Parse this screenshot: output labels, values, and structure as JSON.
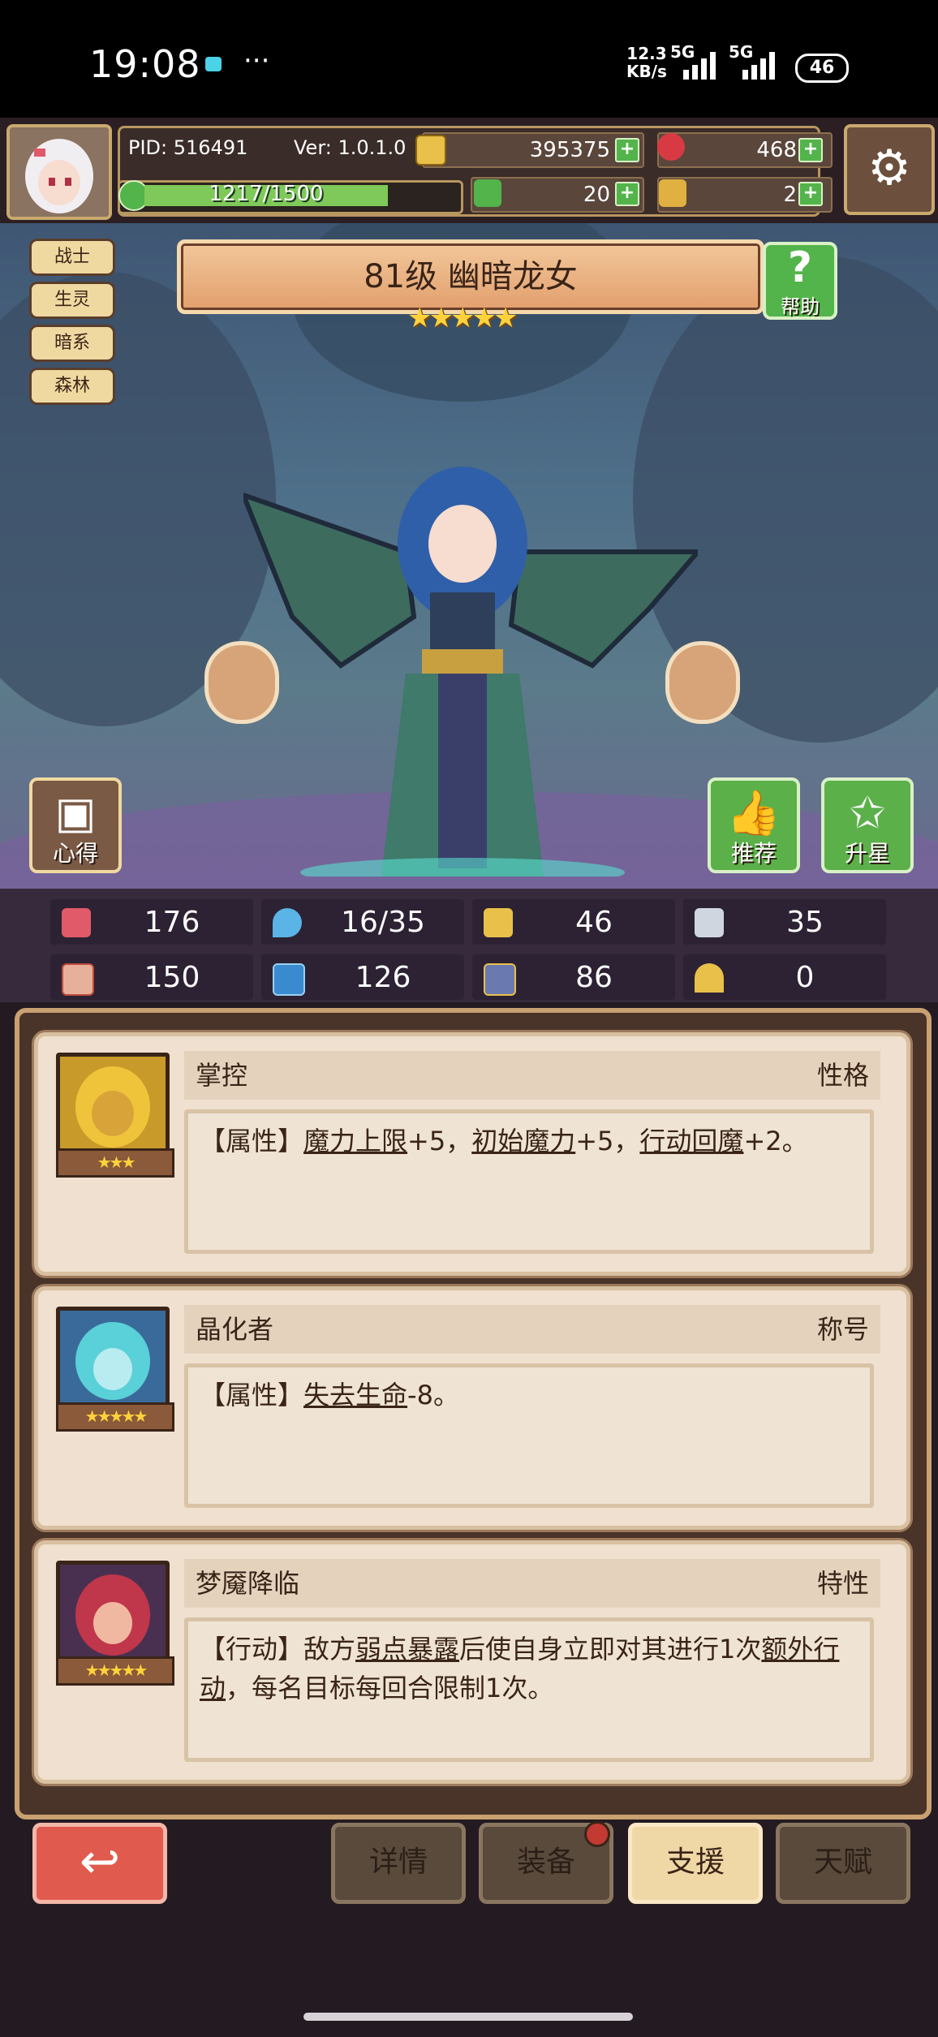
{
  "status_bar": {
    "time": "19:08",
    "more": "···",
    "net_speed_top": "12.3",
    "net_speed_unit": "KB/s",
    "sig1": "5G",
    "sig2": "5G",
    "battery": "46"
  },
  "player": {
    "pid": "PID: 516491",
    "version": "Ver: 1.0.1.0",
    "xp": "1217/1500",
    "xp_fraction": 0.81
  },
  "resources": {
    "gold": "395375",
    "gem": "468",
    "clover": "20",
    "key": "2"
  },
  "tags": [
    "战士",
    "生灵",
    "暗系",
    "森林"
  ],
  "hero": {
    "title": "81级 幽暗龙女",
    "stars": "★★★★★",
    "help_label": "帮助"
  },
  "side_buttons": {
    "notes": "心得",
    "recommend": "推荐",
    "star_up": "升星"
  },
  "stats": {
    "hp": "176",
    "mana": "16/35",
    "defense": "46",
    "speed": "35",
    "attack": "150",
    "magic": "126",
    "level_stat": "86",
    "luck": "0"
  },
  "cards": [
    {
      "name": "掌控",
      "type": "性格",
      "stars": "★★★",
      "parts": [
        "【属性】",
        "魔力上限",
        "+5，",
        "初始魔力",
        "+5，",
        "行动回魔",
        "+2。"
      ]
    },
    {
      "name": "晶化者",
      "type": "称号",
      "stars": "★★★★★",
      "parts": [
        "【属性】",
        "失去生命",
        "-8。"
      ]
    },
    {
      "name": "梦魇降临",
      "type": "特性",
      "stars": "★★★★★",
      "parts": [
        "【行动】敌方",
        "弱点暴露",
        "后使自身立即对其进行1次",
        "额外行动",
        "，每名目标每回合限制1次。"
      ]
    }
  ],
  "nav": {
    "back": "↩",
    "details": "详情",
    "equipment": "装备",
    "support": "支援",
    "talent": "天赋"
  },
  "colors": {
    "accent_green": "#52b44a",
    "accent_red": "#e05a4e",
    "card_bg": "#efe0cf",
    "star": "#ffd23c"
  }
}
